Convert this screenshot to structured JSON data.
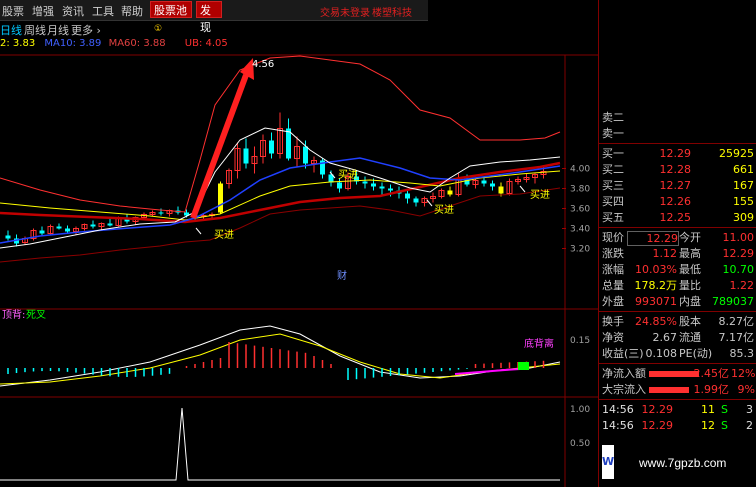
{
  "menu": {
    "items": [
      "股票",
      "增强",
      "资讯",
      "工具",
      "帮助"
    ],
    "pool": "股票池",
    "pool_badge": "①",
    "discover": "发现",
    "status_left": "交易未登录",
    "status_right": "楼塑科技"
  },
  "tabs": {
    "items": [
      "日线",
      "周线",
      "月线",
      "更多 ›"
    ]
  },
  "ma_line": {
    "ma_left": "2: 3.83",
    "ma10": "MA10: 3.89",
    "ma60": "MA60: 3.88",
    "ub": "UB: 4.05"
  },
  "kline": {
    "high_label": "4.56",
    "buy_label": "买进",
    "fin_label": "财",
    "y_ticks": [
      "4.00",
      "3.80",
      "3.60",
      "3.40",
      "3.20"
    ]
  },
  "macd": {
    "top_label": "顶背:",
    "dead_label": "死叉",
    "bottom_label": "底背离",
    "y_tick": "0.15"
  },
  "bottom_panel": {
    "y_ticks": [
      "1.00",
      "0.50"
    ]
  },
  "quote": {
    "asks": [
      {
        "label": "卖二",
        "price": "",
        "vol": ""
      },
      {
        "label": "卖一",
        "price": "",
        "vol": ""
      }
    ],
    "bids": [
      {
        "label": "买一",
        "price": "12.29",
        "vol": "25925"
      },
      {
        "label": "买二",
        "price": "12.28",
        "vol": "661"
      },
      {
        "label": "买三",
        "price": "12.27",
        "vol": "167"
      },
      {
        "label": "买四",
        "price": "12.26",
        "vol": "155"
      },
      {
        "label": "买五",
        "price": "12.25",
        "vol": "309"
      }
    ],
    "stats": [
      {
        "l1": "现价",
        "v1": "12.29",
        "l2": "今开",
        "v2": "11.00"
      },
      {
        "l1": "涨跌",
        "v1": "1.12",
        "l2": "最高",
        "v2": "12.29"
      },
      {
        "l1": "涨幅",
        "v1": "10.03%",
        "l2": "最低",
        "v2": "10.70"
      },
      {
        "l1": "总量",
        "v1": "178.2万",
        "l2": "量比",
        "v2": "1.22"
      },
      {
        "l1": "外盘",
        "v1": "993071",
        "l2": "内盘",
        "v2": "789037"
      }
    ],
    "stats2": [
      {
        "l1": "换手",
        "v1": "24.85%",
        "l2": "股本",
        "v2": "8.27亿"
      },
      {
        "l1": "净资",
        "v1": "2.67",
        "l2": "流通",
        "v2": "7.17亿"
      },
      {
        "l1": "收益(三)",
        "v1": "0.108",
        "l2": "PE(动)",
        "v2": "85.3"
      }
    ],
    "flows": [
      {
        "label": "净流入额",
        "value": "2.45亿",
        "pct": "12%"
      },
      {
        "label": "大宗流入",
        "value": "1.99亿",
        "pct": "9%"
      }
    ],
    "ticks": [
      {
        "time": "14:56",
        "price": "12.29",
        "vol": "11",
        "side": "S",
        "n": "3"
      },
      {
        "time": "14:56",
        "price": "12.29",
        "vol": "12",
        "side": "S",
        "n": "2"
      }
    ],
    "watermark": "www.7gpzb.com",
    "logo_letter": "W"
  },
  "colors": {
    "up": "#ff3030",
    "down": "#00ffff",
    "yellow": "#ffff00",
    "white": "#ffffff",
    "blue": "#2040ff",
    "darkred": "#c00000",
    "green": "#00ff00",
    "magenta": "#ff00ff"
  }
}
